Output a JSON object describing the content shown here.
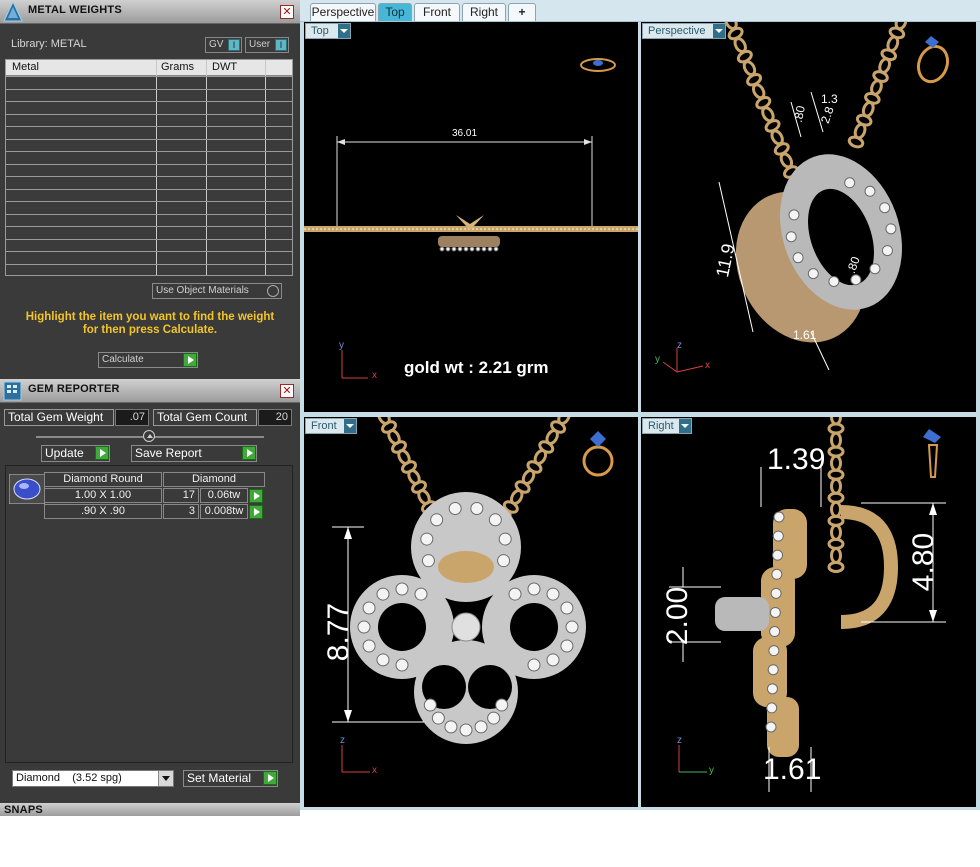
{
  "metal_weights": {
    "title": "METAL WEIGHTS",
    "library_label": "Library: METAL",
    "toggle_gv": "GV",
    "toggle_user": "User",
    "columns": [
      "Metal",
      "Grams",
      "DWT"
    ],
    "use_object_materials": "Use Object Materials",
    "hint": "Highlight the item you want to find the weight for then press Calculate.",
    "calculate_label": "Calculate"
  },
  "gem_reporter": {
    "title": "GEM REPORTER",
    "total_gem_weight_label": "Total Gem Weight",
    "total_gem_weight": ".07",
    "total_gem_count_label": "Total Gem Count",
    "total_gem_count": "20",
    "update_label": "Update",
    "save_report_label": "Save Report",
    "gem_header": {
      "cut": "Diamond Round",
      "material": "Diamond"
    },
    "rows": [
      {
        "size": "1.00 X 1.00",
        "count": "17",
        "weight": "0.06tw"
      },
      {
        "size": ".90 X .90",
        "count": "3",
        "weight": "0.008tw"
      }
    ],
    "material_select": "Diamond    (3.52 spg)",
    "set_material_label": "Set Material"
  },
  "snaps_title": "SNAPS",
  "tabs": [
    "Perspective",
    "Top",
    "Front",
    "Right",
    "+"
  ],
  "active_tab": "Top",
  "viewports": {
    "top": {
      "label": "Top",
      "dimension": "36.01",
      "overlay": "gold wt :  2.21 grm",
      "axes": {
        "vertical": "y",
        "horizontal": "x"
      }
    },
    "perspective": {
      "label": "Perspective",
      "dims": [
        "11.9",
        ".80",
        "1.3",
        "2.8",
        ".80",
        "1.61"
      ],
      "axes": {
        "vertical": "z",
        "horizontal": "x",
        "depth": "y"
      }
    },
    "front": {
      "label": "Front",
      "dimension": "8.77",
      "axes": {
        "vertical": "z",
        "horizontal": "x"
      }
    },
    "right": {
      "label": "Right",
      "dims": {
        "top": "1.39",
        "right": "4.80",
        "left": "2.00",
        "bottom": "1.61"
      },
      "axes": {
        "vertical": "z",
        "horizontal": "y"
      }
    }
  },
  "colors": {
    "gold": "#c9a56b",
    "silver": "#c8c8c8",
    "accent": "#46b7d6",
    "hint_yellow": "#f2c52a"
  }
}
